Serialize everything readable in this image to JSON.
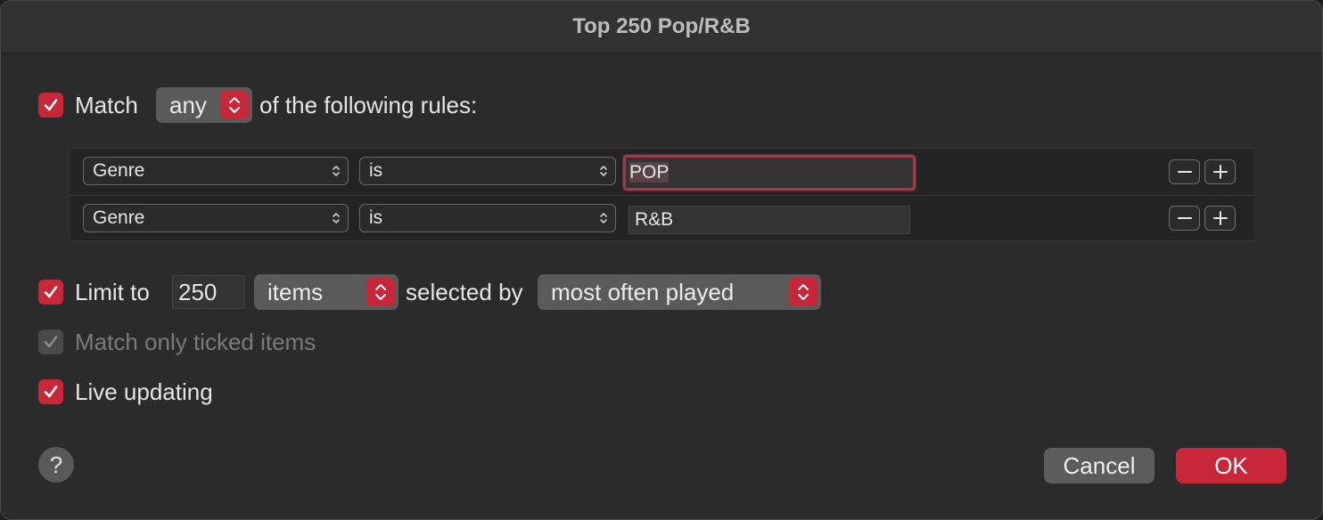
{
  "window": {
    "title": "Top 250 Pop/R&B"
  },
  "match": {
    "checked": true,
    "label": "Match",
    "mode": "any",
    "suffix": "of the following rules:"
  },
  "rules": [
    {
      "field": "Genre",
      "operator": "is",
      "value": "POP",
      "focused": true
    },
    {
      "field": "Genre",
      "operator": "is",
      "value": "R&B",
      "focused": false
    }
  ],
  "limit": {
    "checked": true,
    "label": "Limit to",
    "count": "250",
    "unit": "items",
    "selected_by_label": "selected by",
    "selected_by": "most often played"
  },
  "match_ticked": {
    "checked": true,
    "disabled": true,
    "label": "Match only ticked items"
  },
  "live_updating": {
    "checked": true,
    "label": "Live updating"
  },
  "footer": {
    "help": "?",
    "cancel": "Cancel",
    "ok": "OK"
  },
  "colors": {
    "accent": "#c8273a",
    "window_bg": "#2b2b2b",
    "rule_bg": "#232323"
  },
  "icons": [
    "checkmark-icon",
    "updown-chevron-icon",
    "minus-icon",
    "plus-icon",
    "help-icon"
  ]
}
